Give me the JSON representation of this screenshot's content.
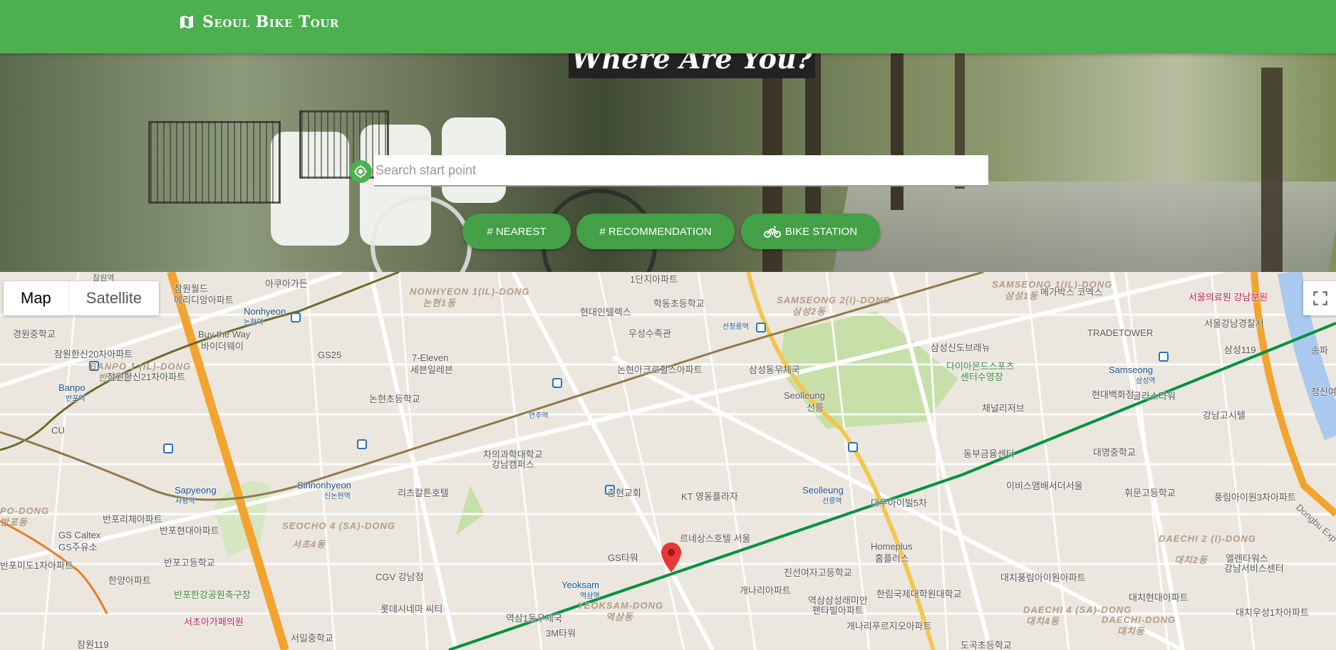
{
  "app": {
    "brand": "Seoul Bike Tour",
    "brand_icon": "map-icon"
  },
  "hero": {
    "title": "Where Are You?",
    "search": {
      "placeholder": "Search start point",
      "value": ""
    },
    "buttons": [
      {
        "label": "# NEAREST"
      },
      {
        "label": "# RECOMMENDATION"
      },
      {
        "label": "BIKE STATION",
        "icon": "bicycle-icon"
      }
    ]
  },
  "map": {
    "type_control": {
      "options": [
        "Map",
        "Satellite"
      ],
      "selected": "Map"
    },
    "fullscreen_icon": "fullscreen-icon",
    "districts": [
      "NONHYEON 1(IL)-DONG",
      "논현1동",
      "SAMSEONG 2(I)-DONG",
      "삼성2동",
      "SAMSEONG 1(IL)-DONG",
      "삼성1동",
      "BANPO 1 (IL)-DONG",
      "반포1동",
      "SEOCHO 4 (SA)-DONG",
      "서초4동",
      "YEOKSAM-DONG",
      "역삼동",
      "DAECHI 2 (I)-DONG",
      "대치2동",
      "DAECHI 4 (SA)-DONG",
      "대치4동",
      "DAECHI-DONG",
      "대치동",
      "PO-DONG",
      "반포동"
    ],
    "stations": [
      "Nonhyeon",
      "논현역",
      "Banpo",
      "반포역",
      "Sapyeong",
      "사평역",
      "Sinnonhyeon",
      "신논현역",
      "언주역",
      "선정릉역",
      "Seolleung",
      "선릉역",
      "Samseong",
      "삼성역",
      "Yeoksam",
      "역삼역"
    ],
    "places": [
      "잠원역",
      "아쿠아가든",
      "잠원월드",
      "메리디앙아파트",
      "경원중학교",
      "잠원한신20차아파트",
      "잠원한신21차아파트",
      "Buy the Way",
      "바이더웨이",
      "GS25",
      "CU",
      "7-Eleven",
      "세븐일레븐",
      "논현초등학교",
      "현대인텔렉스",
      "학동초등학교",
      "우성수족관",
      "논현아크로힐스아파트",
      "1단지아파트",
      "차의과학대학교",
      "강남캠퍼스",
      "리츠칼튼호텔",
      "충현교회",
      "KT 영동플라자",
      "르네상스호텔 서울",
      "GS타워",
      "CGV 강남점",
      "롯데시네마 씨티",
      "역삼1동우체국",
      "3M타워",
      "서일중학교",
      "반포리체아파트",
      "반포현대아파트",
      "GS Caltex",
      "GS주유소",
      "반포미도1차아파트",
      "한양아파트",
      "반포고등학교",
      "잠원119",
      "반포한강공원축구장",
      "서초아가페의원",
      "삼성동우체국",
      "Seolleung",
      "선릉",
      "삼성신도브래뉴",
      "다이아몬드스포츠",
      "센터수영장",
      "채널리저브",
      "현대백화점",
      "글라스타워",
      "동부금융센터",
      "이비스앰배서더서울",
      "대우아이빌5차",
      "진선여자고등학교",
      "역삼삼성래미안",
      "펜타빌아파트",
      "개나리아파트",
      "Homeplus",
      "홈플러스",
      "한림국제대학원대학교",
      "대치풍림아이원아파트",
      "개나리푸르지오아파트",
      "도곡초등학교",
      "메가박스 코엑스",
      "서울의료원 강남분원",
      "서울강남경찰서",
      "TRADETOWER",
      "삼성119",
      "강남고시텔",
      "대명중학교",
      "휘문고등학교",
      "풍림아이원3차아파트",
      "대치현대아파트",
      "엘렌타워스",
      "강남서비스센터",
      "대치우성1차아파트",
      "Dongbu Exp",
      "정신여",
      "송파"
    ],
    "selected_marker": "map-pin-icon"
  },
  "colors": {
    "primary": "#4caf50",
    "button": "#43a047",
    "marker": "#e53935",
    "subway_line2": "#00923f",
    "subway_line9": "#8f7a4a",
    "subway_line3": "#ef7c1c"
  }
}
